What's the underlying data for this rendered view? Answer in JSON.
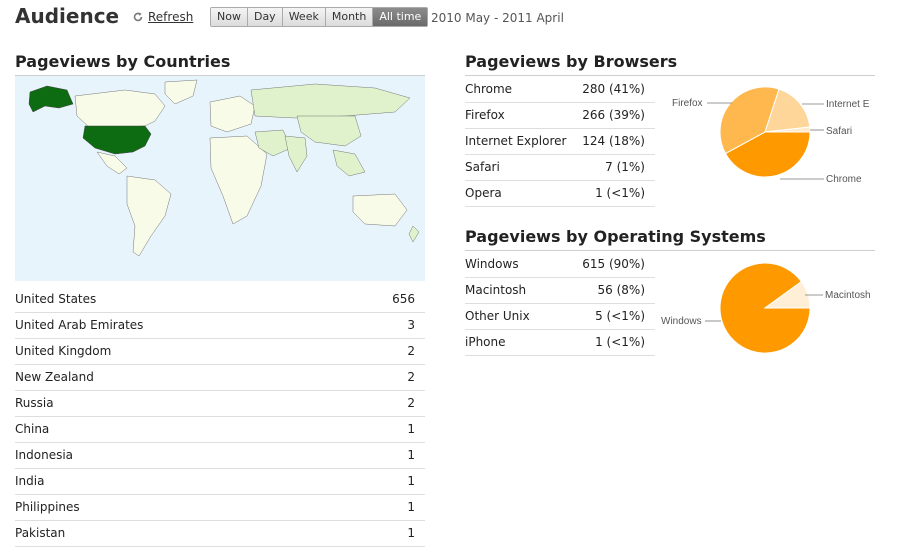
{
  "header": {
    "title": "Audience",
    "refresh_label": "Refresh",
    "ranges": [
      "Now",
      "Day",
      "Week",
      "Month",
      "All time"
    ],
    "active_range": "All time",
    "date_range": "2010 May - 2011 April"
  },
  "countries": {
    "title": "Pageviews by Countries",
    "rows": [
      {
        "name": "United States",
        "value": "656"
      },
      {
        "name": "United Arab Emirates",
        "value": "3"
      },
      {
        "name": "United Kingdom",
        "value": "2"
      },
      {
        "name": "New Zealand",
        "value": "2"
      },
      {
        "name": "Russia",
        "value": "2"
      },
      {
        "name": "China",
        "value": "1"
      },
      {
        "name": "Indonesia",
        "value": "1"
      },
      {
        "name": "India",
        "value": "1"
      },
      {
        "name": "Philippines",
        "value": "1"
      },
      {
        "name": "Pakistan",
        "value": "1"
      }
    ]
  },
  "browsers": {
    "title": "Pageviews by Browsers",
    "rows": [
      {
        "name": "Chrome",
        "value": "280 (41%)"
      },
      {
        "name": "Firefox",
        "value": "266 (39%)"
      },
      {
        "name": "Internet Explorer",
        "value": "124 (18%)"
      },
      {
        "name": "Safari",
        "value": "7 (1%)"
      },
      {
        "name": "Opera",
        "value": "1 (<1%)"
      }
    ],
    "pie_labels": {
      "firefox": "Firefox",
      "ie": "Internet E",
      "safari": "Safari",
      "chrome": "Chrome"
    }
  },
  "os": {
    "title": "Pageviews by Operating Systems",
    "rows": [
      {
        "name": "Windows",
        "value": "615 (90%)"
      },
      {
        "name": "Macintosh",
        "value": "56 (8%)"
      },
      {
        "name": "Other Unix",
        "value": "5 (<1%)"
      },
      {
        "name": "iPhone",
        "value": "1 (<1%)"
      }
    ],
    "pie_labels": {
      "windows": "Windows",
      "mac": "Macintosh"
    }
  },
  "colors": {
    "map_ocean": "#e7f4fb",
    "map_land": "#f7fbe8",
    "map_highlight": "#0d6b12",
    "map_light": "#dff2cc",
    "pie_chrome": "#ff9900",
    "pie_firefox": "#ffb84d",
    "pie_ie": "#ffd699",
    "pie_safari": "#ffeacc",
    "pie_windows": "#ff9900",
    "pie_mac": "#ffefd6"
  }
}
